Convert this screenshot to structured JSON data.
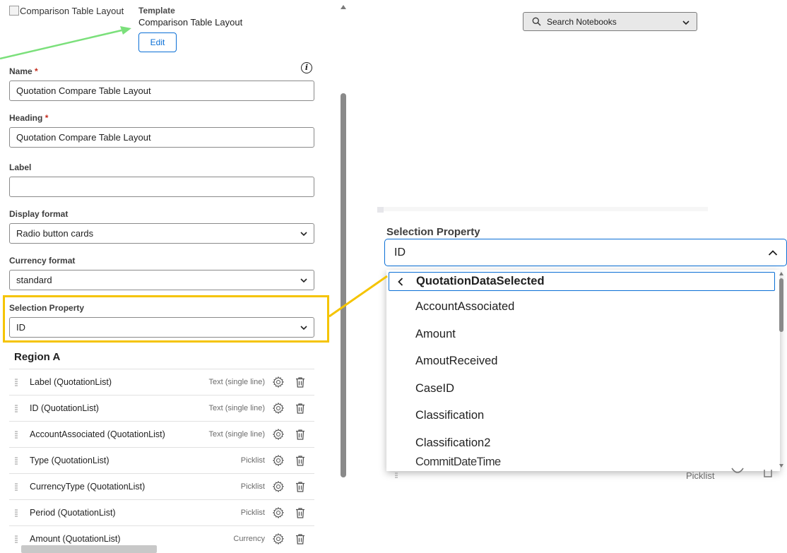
{
  "template": {
    "image_alt": "Comparison Table Layout",
    "label": "Template",
    "name": "Comparison Table Layout",
    "edit_label": "Edit"
  },
  "fields": {
    "name": {
      "label": "Name",
      "required_mark": "*",
      "value": "Quotation Compare Table Layout"
    },
    "heading": {
      "label": "Heading",
      "required_mark": "*",
      "value": "Quotation Compare Table Layout"
    },
    "label": {
      "label": "Label",
      "value": ""
    },
    "display_format": {
      "label": "Display format",
      "value": "Radio button cards"
    },
    "currency_format": {
      "label": "Currency format",
      "value": "standard"
    },
    "selection_property": {
      "label": "Selection Property",
      "value": "ID"
    }
  },
  "info_glyph": "i",
  "region": {
    "title": "Region A",
    "rows": [
      {
        "name": "Label (QuotationList)",
        "type": "Text (single line)"
      },
      {
        "name": "ID (QuotationList)",
        "type": "Text (single line)"
      },
      {
        "name": "AccountAssociated (QuotationList)",
        "type": "Text (single line)"
      },
      {
        "name": "Type (QuotationList)",
        "type": "Picklist"
      },
      {
        "name": "CurrencyType (QuotationList)",
        "type": "Picklist"
      },
      {
        "name": "Period (QuotationList)",
        "type": "Picklist"
      },
      {
        "name": "Amount (QuotationList)",
        "type": "Currency"
      }
    ]
  },
  "search_notebooks": {
    "placeholder": "Search Notebooks"
  },
  "zoom": {
    "label": "Selection Property",
    "value": "ID",
    "parent_option": "QuotationDataSelected",
    "options": [
      "AccountAssociated",
      "Amount",
      "AmoutReceived",
      "CaseID",
      "Classification",
      "Classification2"
    ],
    "cut_option": "CommitDateTime",
    "under_row_type": "Picklist"
  },
  "colors": {
    "accent": "#0a6fd6",
    "highlight": "#f5c400",
    "green_arrow": "#7be07b",
    "required": "#c42b1c"
  },
  "icons": {
    "search": "search-icon",
    "chevron_down": "chevron-down-icon",
    "chevron_up": "chevron-up-icon",
    "chevron_left": "chevron-left-icon",
    "gear": "gear-icon",
    "trash": "trash-icon",
    "grip": "drag-handle-icon",
    "info": "info-icon"
  }
}
